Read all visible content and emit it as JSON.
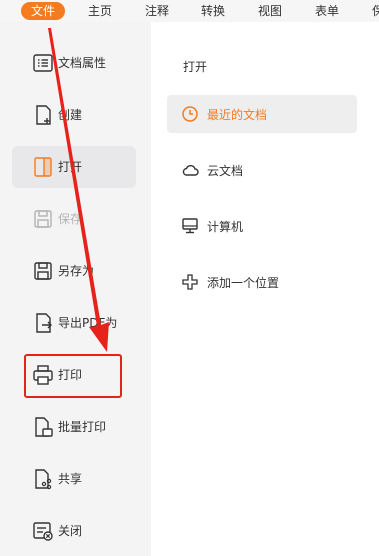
{
  "menubar": {
    "items": [
      {
        "label": "文件",
        "active": true
      },
      {
        "label": "主页"
      },
      {
        "label": "注释"
      },
      {
        "label": "转换"
      },
      {
        "label": "视图"
      },
      {
        "label": "表单"
      },
      {
        "label": "保"
      }
    ]
  },
  "sidebar": {
    "items": [
      {
        "label": "文档属性",
        "icon": "document-properties-icon"
      },
      {
        "label": "创建",
        "icon": "create-document-icon"
      },
      {
        "label": "打开",
        "icon": "open-folder-icon",
        "selected": true
      },
      {
        "label": "保存",
        "icon": "save-icon",
        "disabled": true
      },
      {
        "label": "另存为",
        "icon": "save-as-icon"
      },
      {
        "label": "导出PDF为",
        "icon": "export-pdf-icon"
      },
      {
        "label": "打印",
        "icon": "printer-icon"
      },
      {
        "label": "批量打印",
        "icon": "batch-print-icon"
      },
      {
        "label": "共享",
        "icon": "share-icon"
      },
      {
        "label": "关闭",
        "icon": "close-document-icon"
      }
    ]
  },
  "open_panel": {
    "title": "打开",
    "items": [
      {
        "label": "最近的文档",
        "icon": "clock-icon",
        "selected": true
      },
      {
        "label": "云文档",
        "icon": "cloud-icon"
      },
      {
        "label": "计算机",
        "icon": "computer-icon"
      },
      {
        "label": "添加一个位置",
        "icon": "plus-icon"
      }
    ]
  },
  "colors": {
    "accent": "#f47b20",
    "annotation": "#e5231a"
  }
}
